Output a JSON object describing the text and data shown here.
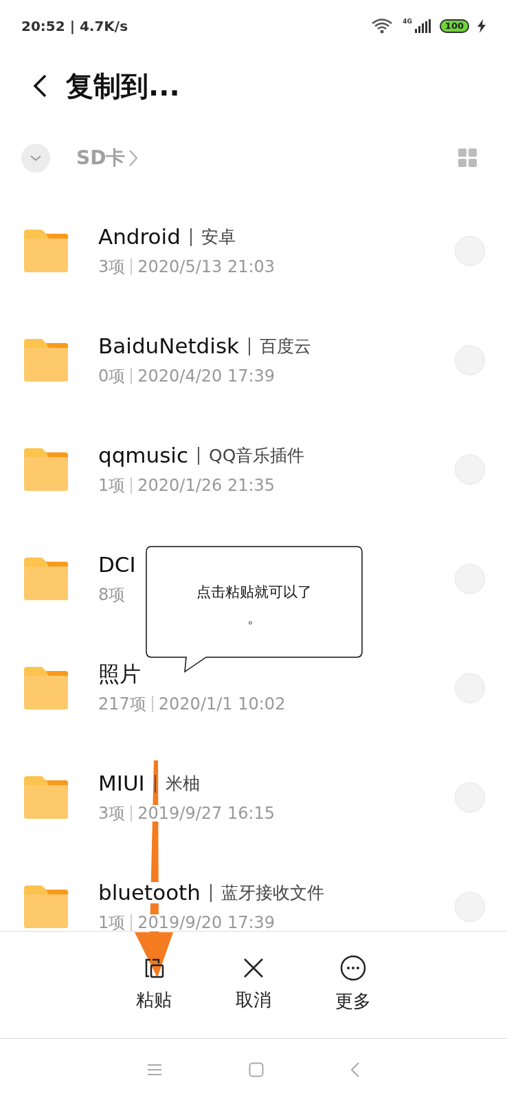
{
  "status_bar": {
    "time": "20:52 | 4.7K/s",
    "network": "4G",
    "battery": "100"
  },
  "header": {
    "title": "复制到..."
  },
  "breadcrumb": {
    "path": "SD卡"
  },
  "folders": [
    {
      "name": "Android",
      "alias": "安卓",
      "count": "3项",
      "date": "2020/5/13 21:03",
      "selected": false
    },
    {
      "name": "BaiduNetdisk",
      "alias": "百度云",
      "count": "0项",
      "date": "2020/4/20 17:39",
      "selected": false
    },
    {
      "name": "qqmusic",
      "alias": "QQ音乐插件",
      "count": "1项",
      "date": "2020/1/26 21:35",
      "selected": false
    },
    {
      "name": "DCI",
      "count": "8项",
      "selected": false
    },
    {
      "name": "照片",
      "count": "217项",
      "date": "2020/1/1 10:02",
      "selected": false
    },
    {
      "name": "MIUI",
      "alias": "米柚",
      "count": "3项",
      "date": "2019/9/27 16:15",
      "selected": false
    },
    {
      "name": "bluetooth",
      "alias": "蓝牙接收文件",
      "count": "1项",
      "date": "2019/9/20 17:39",
      "selected": false
    }
  ],
  "actions": [
    {
      "kind": "paste",
      "label": "粘贴"
    },
    {
      "kind": "cancel",
      "label": "取消"
    },
    {
      "kind": "more",
      "label": "更多"
    }
  ],
  "callout": {
    "text": "点击粘贴就可以了。"
  }
}
